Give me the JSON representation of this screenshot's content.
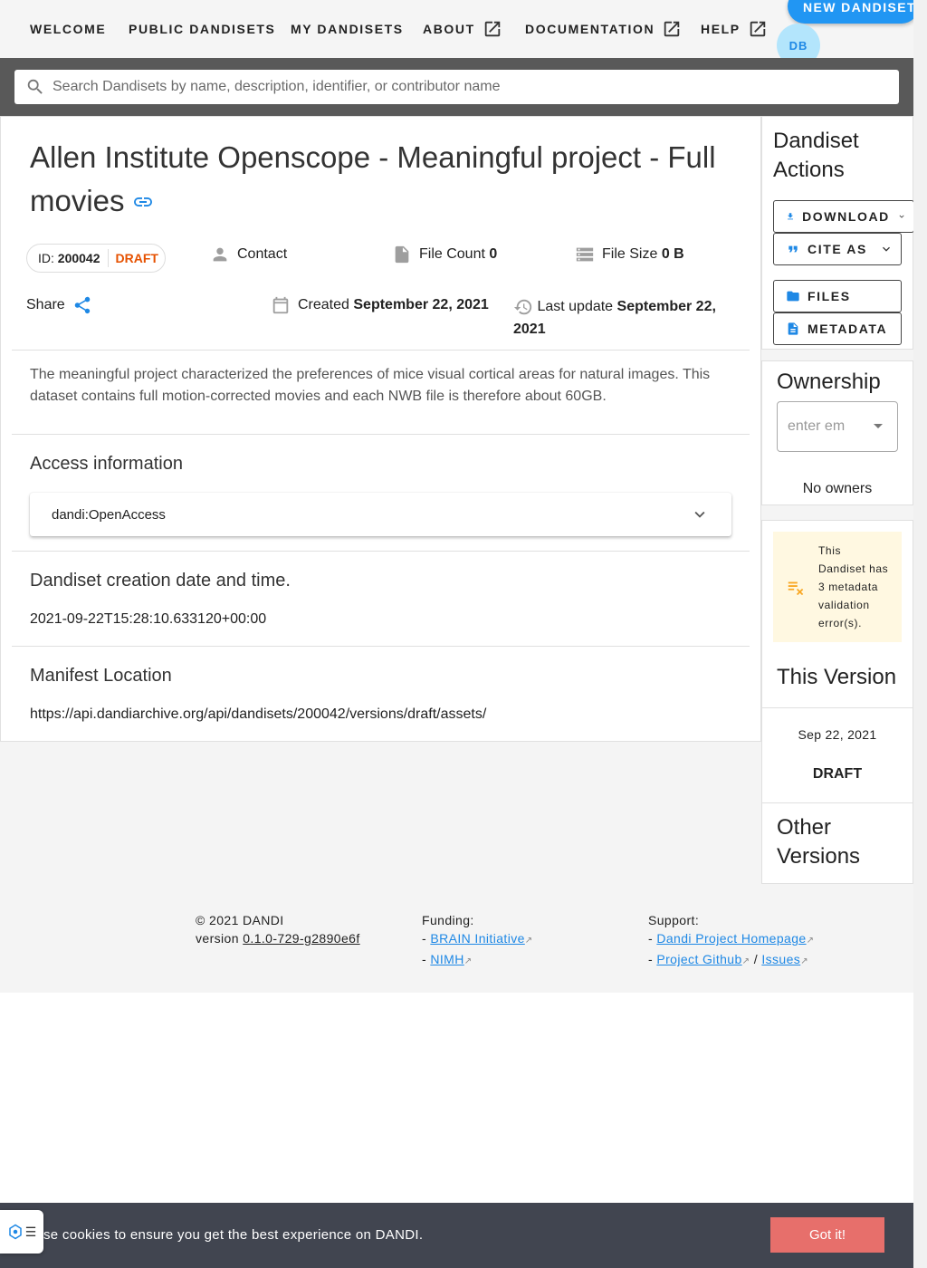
{
  "nav": {
    "items": [
      {
        "label": "WELCOME",
        "external": false
      },
      {
        "label": "PUBLIC DANDISETS",
        "external": false
      },
      {
        "label": "MY DANDISETS",
        "external": false
      },
      {
        "label": "ABOUT",
        "external": true
      },
      {
        "label": "DOCUMENTATION",
        "external": true
      },
      {
        "label": "HELP",
        "external": true
      }
    ],
    "new_button": "NEW DANDISET",
    "avatar_initials": "DB"
  },
  "search": {
    "placeholder": "Search Dandisets by name, description, identifier, or contributor name"
  },
  "dandiset": {
    "title": "Allen Institute Openscope - Meaningful project - Full movies",
    "id_label": "ID:",
    "id": "200042",
    "version_badge": "DRAFT",
    "contact_label": "Contact",
    "file_count_label": "File Count",
    "file_count": "0",
    "file_size_label": "File Size",
    "file_size": "0 B",
    "share_label": "Share",
    "created_label": "Created",
    "created": "September 22, 2021",
    "updated_label": "Last update",
    "updated": "September 22, 2021",
    "description": "The meaningful project characterized the preferences of mice visual cortical areas for natural images. This dataset contains full motion-corrected movies and each NWB file is therefore about 60GB.",
    "access_heading": "Access information",
    "access_value": "dandi:OpenAccess",
    "creation_heading": "Dandiset creation date and time.",
    "creation_value": "2021-09-22T15:28:10.633120+00:00",
    "manifest_heading": "Manifest Location",
    "manifest_value": "https://api.dandiarchive.org/api/dandisets/200042/versions/draft/assets/"
  },
  "actions": {
    "heading": "Dandiset Actions",
    "download": "DOWNLOAD",
    "cite": "CITE AS",
    "files": "FILES",
    "metadata": "METADATA"
  },
  "ownership": {
    "heading": "Ownership",
    "placeholder": "enter em",
    "empty": "No owners"
  },
  "validation": {
    "message": "This Dandiset has 3 metadata validation error(s)."
  },
  "versions": {
    "this_heading": "This Version",
    "this_date": "Sep 22, 2021",
    "this_name": "DRAFT",
    "other_heading": "Other Versions"
  },
  "footer": {
    "copyright": "© 2021 DANDI",
    "version_label": "version",
    "version": "0.1.0-729-g2890e6f",
    "funding_label": "Funding:",
    "funding_links": [
      "BRAIN Initiative",
      "NIMH"
    ],
    "support_label": "Support:",
    "support_homepage": "Dandi Project Homepage",
    "support_github": "Project Github",
    "support_issues": "Issues"
  },
  "cookie": {
    "message": "se cookies to ensure you get the best experience on DANDI.",
    "button": "Got it!"
  },
  "colors": {
    "accent": "#2196f3",
    "draft": "#e65100",
    "cookie_bar": "#414550",
    "cookie_button": "#e76f6b",
    "warning_bg": "#fff8e1"
  }
}
